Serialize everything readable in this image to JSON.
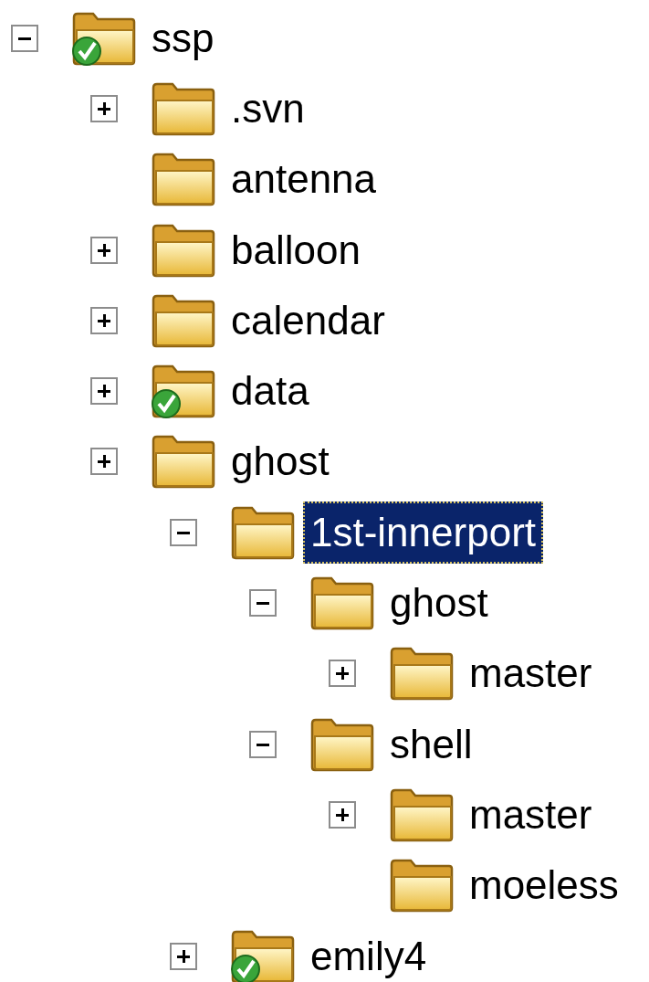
{
  "tree": [
    {
      "label": "ssp",
      "kind": "branch",
      "expanded": true,
      "versioned": true,
      "selected": false,
      "children": [
        {
          "label": ".svn",
          "kind": "branch",
          "expanded": false,
          "versioned": false,
          "selected": false
        },
        {
          "label": "antenna",
          "kind": "leaf",
          "versioned": false,
          "selected": false
        },
        {
          "label": "balloon",
          "kind": "branch",
          "expanded": false,
          "versioned": false,
          "selected": false
        },
        {
          "label": "calendar",
          "kind": "branch",
          "expanded": false,
          "versioned": false,
          "selected": false
        },
        {
          "label": "data",
          "kind": "branch",
          "expanded": false,
          "versioned": true,
          "selected": false
        },
        {
          "label": "ghost",
          "kind": "branch",
          "expanded": false,
          "versioned": false,
          "selected": false,
          "children": [
            {
              "label": "1st-innerport",
              "kind": "branch",
              "expanded": true,
              "versioned": false,
              "selected": true,
              "children": [
                {
                  "label": "ghost",
                  "kind": "branch",
                  "expanded": true,
                  "versioned": false,
                  "selected": false,
                  "children": [
                    {
                      "label": "master",
                      "kind": "branch",
                      "expanded": false,
                      "versioned": false,
                      "selected": false
                    }
                  ]
                },
                {
                  "label": "shell",
                  "kind": "branch",
                  "expanded": true,
                  "versioned": false,
                  "selected": false,
                  "children": [
                    {
                      "label": "master",
                      "kind": "branch",
                      "expanded": false,
                      "versioned": false,
                      "selected": false
                    },
                    {
                      "label": "moeless",
                      "kind": "leaf",
                      "versioned": false,
                      "selected": false
                    }
                  ]
                }
              ]
            },
            {
              "label": "emily4",
              "kind": "branch",
              "expanded": false,
              "versioned": true,
              "selected": false
            }
          ]
        }
      ]
    }
  ]
}
